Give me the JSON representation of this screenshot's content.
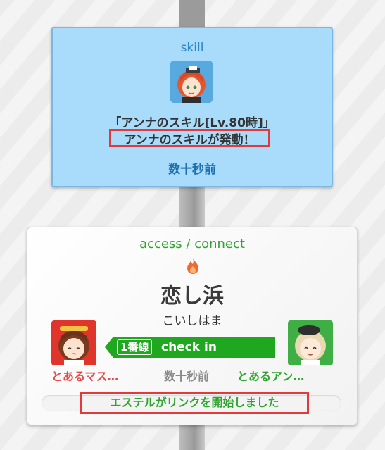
{
  "skill": {
    "title": "skill",
    "avatar": "anna-avatar",
    "name": "「アンナのスキル[Lv.80時]」",
    "message": "アンナのスキルが発動！",
    "time": "数十秒前"
  },
  "access": {
    "title": "access / connect",
    "icon": "flame-icon",
    "station": "恋し浜",
    "station_kana": "こいしはま",
    "line_badge": "1番線",
    "checkin_label": "check in",
    "left_user": "とあるマス…",
    "center_time": "数十秒前",
    "right_user": "とあるアン…",
    "link_message": "エステルがリンクを開始しました"
  },
  "colors": {
    "skill_bg": "#a9dcfb",
    "access_green": "#2fa52f",
    "highlight_red": "#e23a3a",
    "checkin_green": "#1fa81f"
  }
}
